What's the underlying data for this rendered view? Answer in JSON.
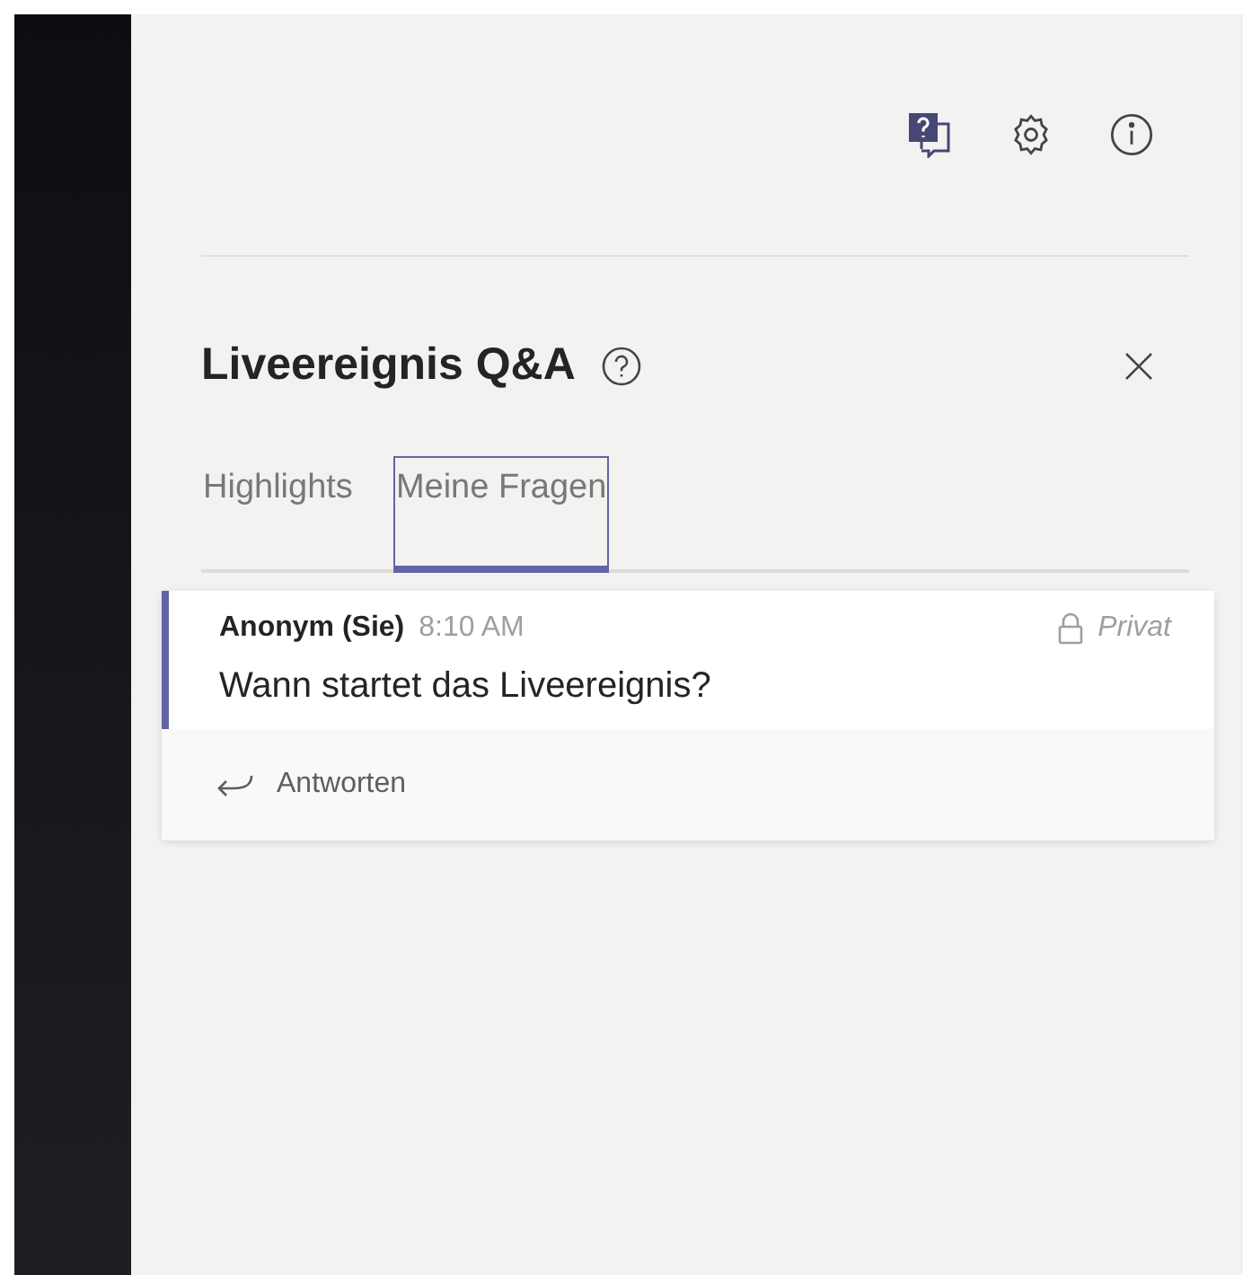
{
  "toolbar": {
    "buttons": [
      {
        "kind": "qa"
      },
      {
        "kind": "settings"
      },
      {
        "kind": "info"
      }
    ]
  },
  "panel": {
    "title": "Liveereignis Q&A"
  },
  "tabs": [
    {
      "label": "Highlights",
      "selected": false
    },
    {
      "label": "Meine Fragen",
      "selected": true
    }
  ],
  "questions": [
    {
      "author": "Anonym (Sie)",
      "time": "8:10 AM",
      "visibility": "Privat",
      "text": "Wann startet das Liveereignis?",
      "reply": "Antworten"
    }
  ]
}
